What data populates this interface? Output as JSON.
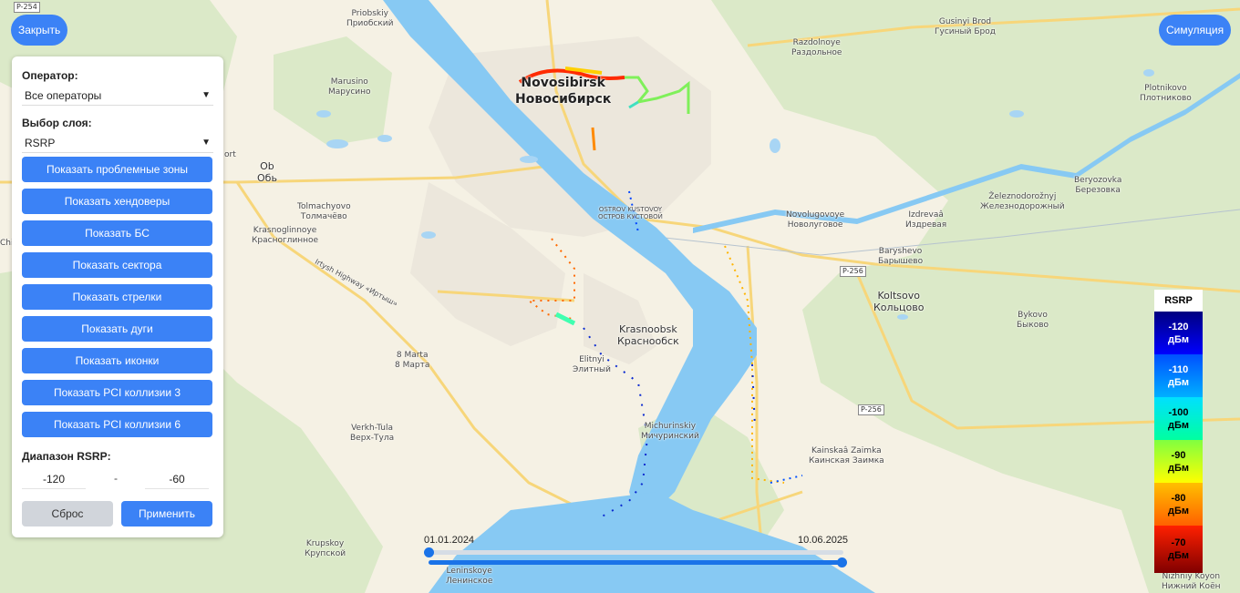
{
  "top_buttons": {
    "close": "Закрыть",
    "simulation": "Симуляция"
  },
  "panel": {
    "operator_label": "Оператор:",
    "operator_value": "Все операторы",
    "layer_label": "Выбор слоя:",
    "layer_value": "RSRP",
    "buttons": [
      "Показать проблемные зоны",
      "Показать хендоверы",
      "Показать БС",
      "Показать сектора",
      "Показать стрелки",
      "Показать дуги",
      "Показать иконки",
      "Показать PCI коллизии 3",
      "Показать PCI коллизии 6"
    ],
    "range_label": "Диапазон RSRP:",
    "range_min": "-120",
    "range_sep": "-",
    "range_max": "-60",
    "reset": "Сброс",
    "apply": "Применить"
  },
  "timeline": {
    "start": "01.01.2024",
    "end": "10.06.2025",
    "start_value": 0,
    "end_value": 1
  },
  "legend": {
    "title": "RSRP",
    "items": [
      {
        "value": "-120",
        "unit": "дБм",
        "color_top": "#000080",
        "color_bot": "#0000ff",
        "text": "#ffffff"
      },
      {
        "value": "-110",
        "unit": "дБм",
        "color_top": "#0050ff",
        "color_bot": "#00b0ff",
        "text": "#ffffff"
      },
      {
        "value": "-100",
        "unit": "дБм",
        "color_top": "#00e0ff",
        "color_bot": "#00ffa0",
        "text": "#000000"
      },
      {
        "value": "-90",
        "unit": "дБм",
        "color_top": "#80ff40",
        "color_bot": "#ffff00",
        "text": "#000000"
      },
      {
        "value": "-80",
        "unit": "дБм",
        "color_top": "#ffc000",
        "color_bot": "#ff6000",
        "text": "#000000"
      },
      {
        "value": "-70",
        "unit": "дБм",
        "color_top": "#ff2000",
        "color_bot": "#800000",
        "text": "#000000"
      }
    ]
  },
  "map_labels": [
    {
      "text": "Novosibirsk",
      "text2": "Новосибирск",
      "size": "big"
    },
    {
      "text": "Krasnoobsk",
      "text2": "Краснообск",
      "size": "mid"
    },
    {
      "text": "Koltsovo",
      "text2": "Кольцово",
      "size": "mid"
    },
    {
      "text": "Ob",
      "text2": "Обь",
      "size": "mid"
    },
    {
      "text": "Priobskiy",
      "text2": "Приобский"
    },
    {
      "text": "Marusino",
      "text2": "Марусино"
    },
    {
      "text": "Razdolnoye",
      "text2": "Раздольное"
    },
    {
      "text": "Gusinyi Brod",
      "text2": "Гусиный Брод"
    },
    {
      "text": "Plotnikovo",
      "text2": "Плотниково"
    },
    {
      "text": "Tolmachyovo",
      "text2": "Толмачёво"
    },
    {
      "text": "Krasnoglinnoye",
      "text2": "Красноглинное"
    },
    {
      "text": "Novolugovoye",
      "text2": "Новолуговое"
    },
    {
      "text": "Izdrevaâ",
      "text2": "Издревая"
    },
    {
      "text": "Beryozovka",
      "text2": "Березовка"
    },
    {
      "text": "Železnodorožnyj",
      "text2": "Железнодорожный"
    },
    {
      "text": "Baryshevo",
      "text2": "Барышево"
    },
    {
      "text": "Bykovo",
      "text2": "Быково"
    },
    {
      "text": "Elitnyi",
      "text2": "Элитный"
    },
    {
      "text": "8 Marta",
      "text2": "8 Марта"
    },
    {
      "text": "Verkh-Tula",
      "text2": "Верх-Тула"
    },
    {
      "text": "Michurinskiy",
      "text2": "Мичуринский"
    },
    {
      "text": "Kainskaâ Zaimka",
      "text2": "Каинская Заимка"
    },
    {
      "text": "Krupskoy",
      "text2": "Крупской"
    },
    {
      "text": "Leninskoye",
      "text2": "Ленинское"
    },
    {
      "text": "Nizhniy Koyon",
      "text2": "Нижний Коён"
    },
    {
      "text": "Chis",
      "text2": ""
    },
    {
      "text": "ort",
      "text2": ""
    },
    {
      "text": "OSTROV KUSTOVOY",
      "text2": "ОСТРОВ КУСТОВОЙ"
    }
  ],
  "road_shields": [
    "P-254",
    "P-256",
    "P-256"
  ],
  "highway_label": "Irtysh Highway «Иртыш»",
  "colors": {
    "accent": "#3b82f6",
    "water": "#87c9f3",
    "land": "#f5f1e4",
    "forest": "#dbe9c8",
    "road": "#f7d67a"
  }
}
